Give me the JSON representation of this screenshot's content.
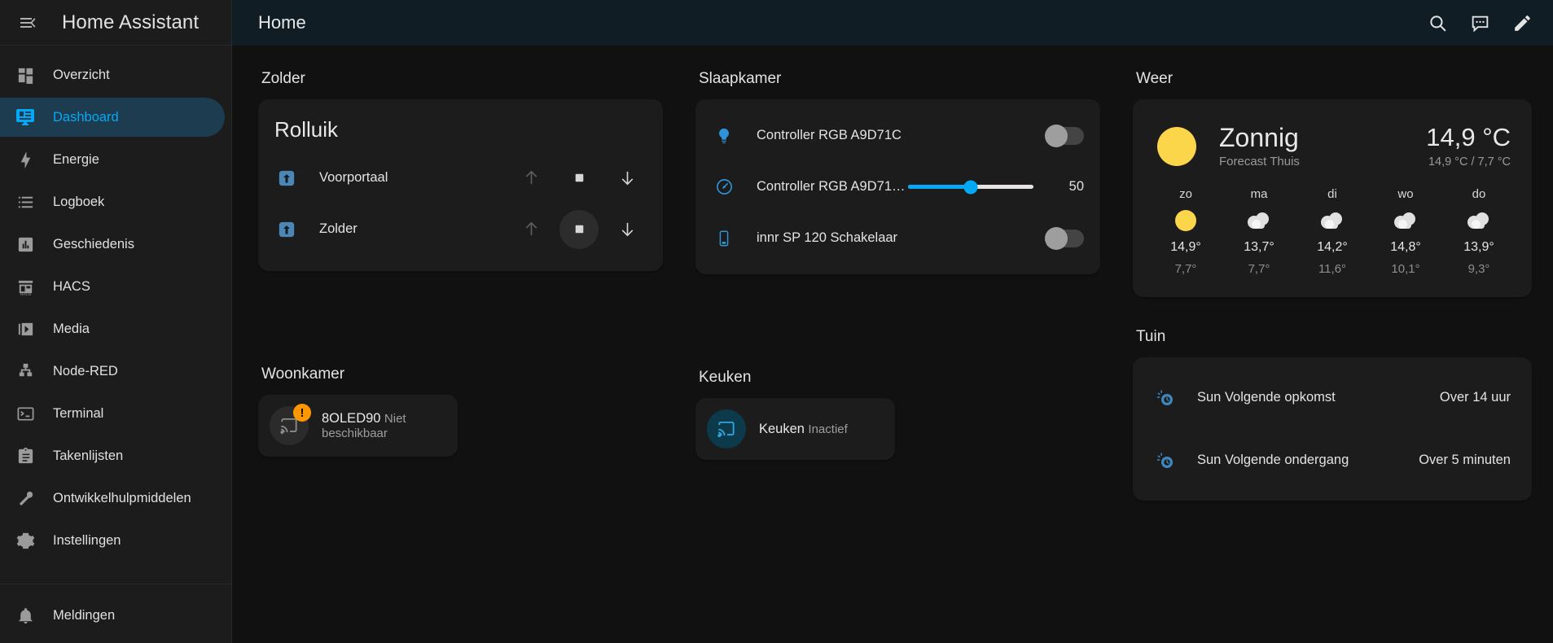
{
  "sidebar": {
    "title": "Home Assistant",
    "menu_icon": "menu-collapse-icon",
    "items": [
      {
        "label": "Overzicht",
        "icon": "view-dashboard-icon",
        "active": false
      },
      {
        "label": "Dashboard",
        "icon": "monitor-dashboard-icon",
        "active": true
      },
      {
        "label": "Energie",
        "icon": "lightning-bolt-icon",
        "active": false
      },
      {
        "label": "Logboek",
        "icon": "format-list-bulleted-icon",
        "active": false
      },
      {
        "label": "Geschiedenis",
        "icon": "chart-box-icon",
        "active": false
      },
      {
        "label": "HACS",
        "icon": "hacs-storefront-icon",
        "active": false
      },
      {
        "label": "Media",
        "icon": "play-box-multiple-icon",
        "active": false
      },
      {
        "label": "Node-RED",
        "icon": "sitemap-icon",
        "active": false
      },
      {
        "label": "Terminal",
        "icon": "console-icon",
        "active": false
      },
      {
        "label": "Takenlijsten",
        "icon": "clipboard-list-icon",
        "active": false
      },
      {
        "label": "Ontwikkelhulpmiddelen",
        "icon": "hammer-wrench-icon",
        "active": false
      },
      {
        "label": "Instellingen",
        "icon": "cog-icon",
        "active": false
      }
    ],
    "footer": [
      {
        "label": "Meldingen",
        "icon": "bell-icon"
      }
    ]
  },
  "topbar": {
    "title": "Home",
    "actions": [
      {
        "name": "search-icon"
      },
      {
        "name": "assist-chat-icon"
      },
      {
        "name": "pencil-edit-icon"
      }
    ]
  },
  "colors": {
    "accent": "#03a9f4",
    "active_bg": "#1d3c50",
    "card_bg": "#1c1c1c",
    "sidebar_bg": "#1c1c1c",
    "topbar_bg": "#101d24",
    "page_bg": "#111111",
    "warning": "#ff9800",
    "sun_yellow": "#fbd64a",
    "cover_icon": "#5a8fbd"
  },
  "sections": {
    "zolder": {
      "title": "Zolder",
      "card_title": "Rolluik",
      "rows": [
        {
          "name": "Voorportaal",
          "icon": "window-shutter-up-icon",
          "up_label": "up-arrow-icon",
          "stop_label": "stop-square-icon",
          "down_label": "down-arrow-icon",
          "up_disabled": true,
          "hovered": false
        },
        {
          "name": "Zolder",
          "icon": "window-shutter-up-icon",
          "up_label": "up-arrow-icon",
          "stop_label": "stop-square-icon",
          "down_label": "down-arrow-icon",
          "up_disabled": true,
          "hovered": true
        }
      ]
    },
    "slaapkamer": {
      "title": "Slaapkamer",
      "rows": [
        {
          "name": "Controller RGB A9D71C",
          "icon": "lightbulb-icon",
          "control": "toggle",
          "state": "off"
        },
        {
          "name": "Controller RGB A9D71…",
          "icon": "speedometer-icon",
          "control": "slider",
          "value": "50",
          "percent": 50
        },
        {
          "name": "innr SP 120 Schakelaar",
          "icon": "power-socket-icon",
          "control": "toggle",
          "state": "off"
        }
      ]
    },
    "weer": {
      "title": "Weer",
      "condition": "Zonnig",
      "entity_name": "Forecast Thuis",
      "condition_icon": "sunny-icon",
      "temperature": "14,9 °C",
      "high_low": "14,9 °C / 7,7 °C",
      "forecast": [
        {
          "day": "zo",
          "icon": "sunny-icon",
          "high": "14,9°",
          "low": "7,7°"
        },
        {
          "day": "ma",
          "icon": "cloudy-icon",
          "high": "13,7°",
          "low": "7,7°"
        },
        {
          "day": "di",
          "icon": "cloudy-icon",
          "high": "14,2°",
          "low": "11,6°"
        },
        {
          "day": "wo",
          "icon": "cloudy-icon",
          "high": "14,8°",
          "low": "10,1°"
        },
        {
          "day": "do",
          "icon": "cloudy-icon",
          "high": "13,9°",
          "low": "9,3°"
        }
      ]
    },
    "woonkamer": {
      "title": "Woonkamer",
      "player": {
        "name": "8OLED90",
        "state": "Niet beschikbaar",
        "icon": "cast-icon",
        "badge": "!",
        "available": false
      }
    },
    "keuken": {
      "title": "Keuken",
      "player": {
        "name": "Keuken",
        "state": "Inactief",
        "icon": "cast-icon",
        "badge": "",
        "available": true
      }
    },
    "tuin": {
      "title": "Tuin",
      "rows": [
        {
          "name": "Sun Volgende opkomst",
          "value": "Over 14 uur",
          "icon": "sun-clock-icon"
        },
        {
          "name": "Sun Volgende ondergang",
          "value": "Over 5 minuten",
          "icon": "sun-clock-icon"
        }
      ]
    }
  }
}
